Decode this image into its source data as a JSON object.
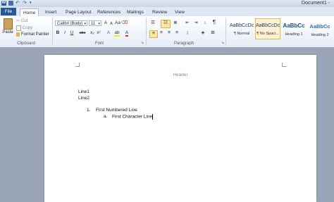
{
  "window": {
    "document_title": "Document1 -"
  },
  "tabs": [
    {
      "label": "File"
    },
    {
      "label": "Home"
    },
    {
      "label": "Insert"
    },
    {
      "label": "Page Layout"
    },
    {
      "label": "References"
    },
    {
      "label": "Mailings"
    },
    {
      "label": "Review"
    },
    {
      "label": "View"
    }
  ],
  "clipboard": {
    "paste": "Paste",
    "cut": "Cut",
    "copy": "Copy",
    "format_painter": "Format Painter",
    "label": "Clipboard"
  },
  "font": {
    "family": "Calibri (Body)",
    "size": "11",
    "label": "Font",
    "bold": "B",
    "italic": "I",
    "underline": "U",
    "strike": "abc"
  },
  "paragraph": {
    "label": "Paragraph"
  },
  "styles": [
    {
      "sample": "AaBbCcDc",
      "name": "¶ Normal"
    },
    {
      "sample": "AaBbCcDc",
      "name": "¶ No Spaci..."
    },
    {
      "sample": "AaBbCc",
      "name": "Heading 1"
    },
    {
      "sample": "AaBbCc",
      "name": "Heading 2"
    }
  ],
  "document": {
    "header": "Header",
    "line1": "Line1",
    "line2": "Line2",
    "num1_marker": "1.",
    "num1_text": "First Numbered Line",
    "alpha_marker": "a.",
    "alpha_text": "First Character Line"
  },
  "colors": {
    "file_tab": "#2a5597",
    "accent": "#2b579a"
  }
}
